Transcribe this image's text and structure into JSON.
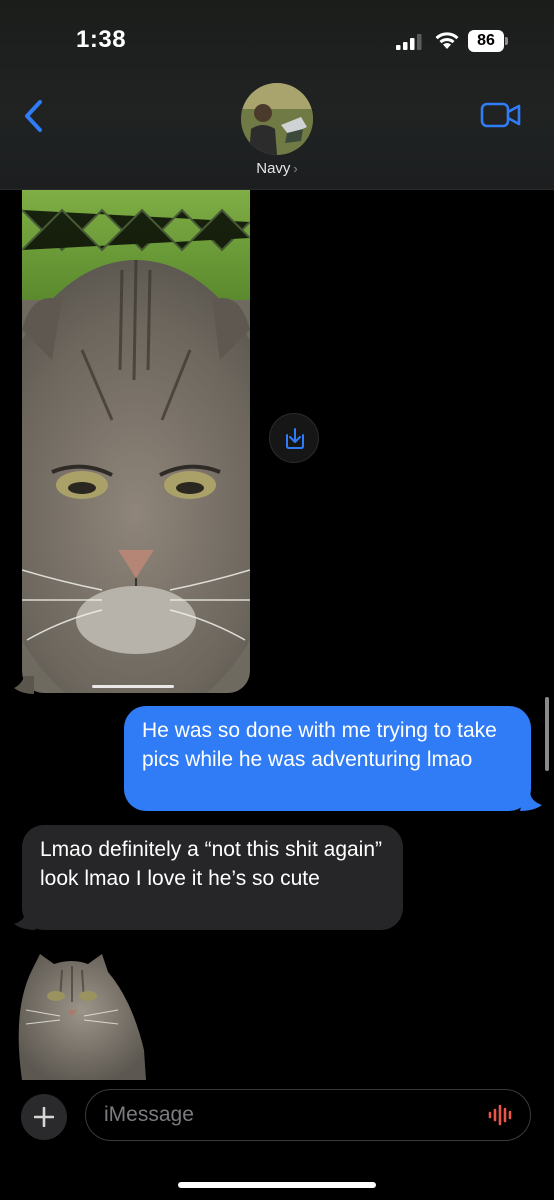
{
  "status_bar": {
    "time": "1:38",
    "battery": "86"
  },
  "header": {
    "contact_name": "Navy",
    "chevron": "›"
  },
  "messages": {
    "outgoing_text": "He was so done with me trying to take pics while he was adventuring lmao",
    "incoming_text": "Lmao definitely a “not this shit again” look lmao I love it he’s so cute"
  },
  "input": {
    "placeholder": "iMessage"
  },
  "icons": {
    "back": "chevron-left-icon",
    "video": "video-camera-icon",
    "save": "download-icon",
    "add": "plus-icon",
    "audio": "waveform-icon"
  },
  "colors": {
    "accent": "#2f7cf6",
    "incoming_bubble": "#262628",
    "audio": "#e8584a"
  }
}
